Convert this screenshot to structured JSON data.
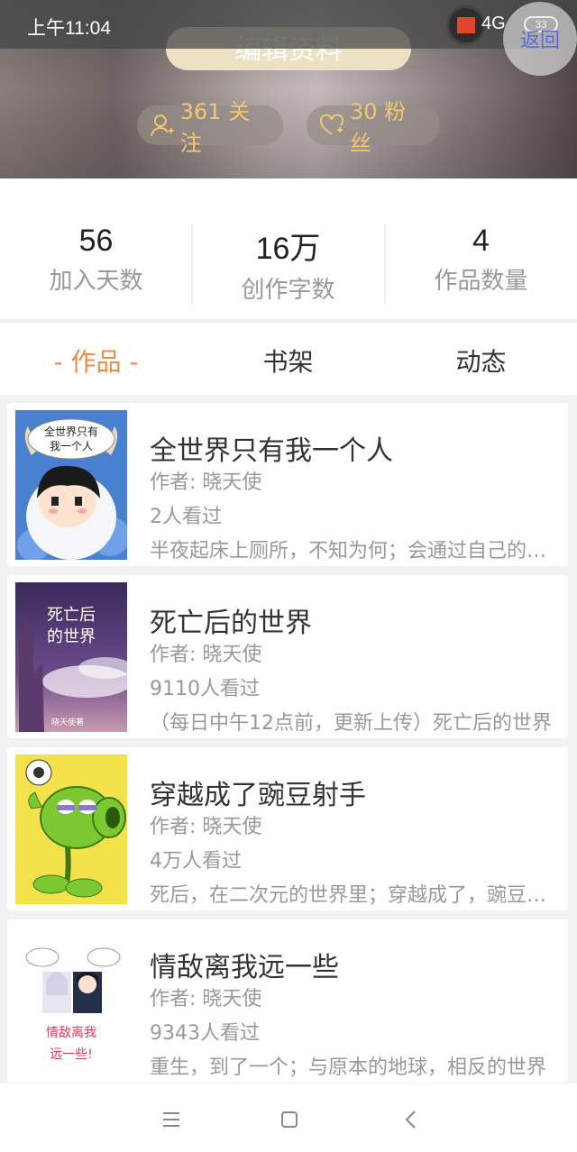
{
  "status_bar": {
    "time": "上午11:04",
    "network": "4G",
    "battery": "33"
  },
  "header": {
    "back_label": "返回",
    "edit_label": "编辑资料",
    "follow_label": "361 关注",
    "fans_label": "30 粉丝"
  },
  "stats": [
    {
      "value": "56",
      "label": "加入天数"
    },
    {
      "value": "16万",
      "label": "创作字数"
    },
    {
      "value": "4",
      "label": "作品数量"
    }
  ],
  "tabs": [
    {
      "label": "- 作品 -",
      "active": true
    },
    {
      "label": "书架",
      "active": false
    },
    {
      "label": "动态",
      "active": false
    }
  ],
  "books": [
    {
      "title": "全世界只有我一个人",
      "author": "作者: 晓天使",
      "views": "2人看过",
      "desc": "半夜起床上厕所，不知为何；会通过自己的双脚穿越到另一个世界",
      "cover_text": "全世界只有我一个人"
    },
    {
      "title": "死亡后的世界",
      "author": "作者: 晓天使",
      "views": "9110人看过",
      "desc": "（每日中午12点前，更新上传）死亡后的世界",
      "cover_text": "死亡后的世界",
      "cover_sub": "晓天使著"
    },
    {
      "title": "穿越成了豌豆射手",
      "author": "作者: 晓天使",
      "views": "4万人看过",
      "desc": "死后，在二次元的世界里；穿越成了，豌豆射手",
      "cover_text": ""
    },
    {
      "title": "情敌离我远一些",
      "author": "作者: 晓天使",
      "views": "9343人看过",
      "desc": "重生，到了一个；与原本的地球，相反的世界",
      "cover_text": "情敌离我远一些!"
    }
  ],
  "colors": {
    "accent": "#f08a45",
    "pill_text": "#f0c86e"
  }
}
